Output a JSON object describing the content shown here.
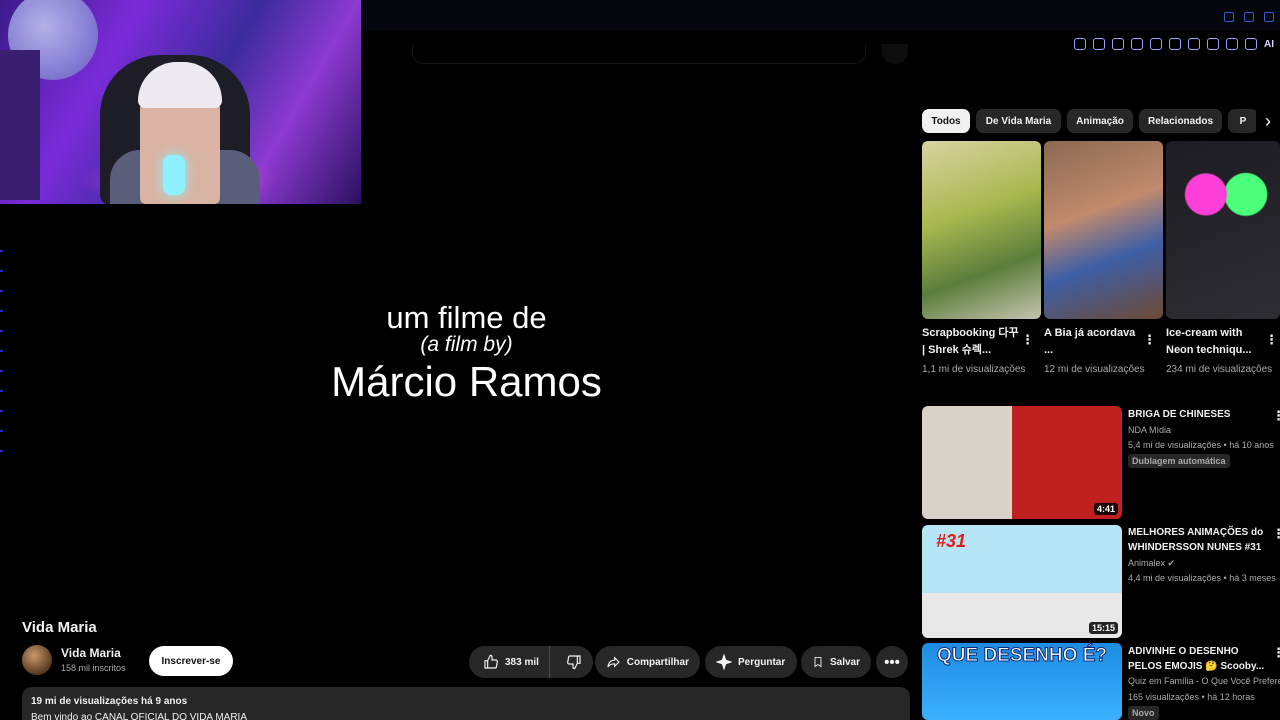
{
  "browser": {
    "ai_label": "AI"
  },
  "video": {
    "credit_line1": "um filme de",
    "credit_line2": "(a film by)",
    "credit_line3": "Márcio Ramos",
    "title": "Vida Maria"
  },
  "channel": {
    "name": "Vida Maria",
    "subscribers": "158 mil inscritos",
    "subscribe_label": "Inscrever-se"
  },
  "actions": {
    "likes": "383 mil",
    "share_label": "Compartilhar",
    "ask_label": "Perguntar",
    "save_label": "Salvar"
  },
  "description": {
    "meta": "19 mi de visualizações  há 9 anos",
    "text": "Bem vindo ao CANAL OFICIAL DO VIDA MARIA"
  },
  "chips": [
    "Todos",
    "De Vida Maria",
    "Animação",
    "Relacionados",
    "P"
  ],
  "shorts": [
    {
      "title": "Scrapbooking 다꾸 | Shrek 슈렉...",
      "views": "1,1 mi de visualizações"
    },
    {
      "title": "A Bia já acordava ...",
      "views": "12 mi de visualizações"
    },
    {
      "title": "Ice-cream with Neon techniqu...",
      "views": "234 mi de visualizações"
    }
  ],
  "sidebar_videos": [
    {
      "title": "BRIGA DE CHINESES",
      "channel": "NDA Mídia",
      "meta": "5,4 mi de visualizações • há 10 anos",
      "badge": "Dublagem automática",
      "duration": "4:41"
    },
    {
      "title": "MELHORES ANIMAÇÕES do WHINDERSSON NUNES #31",
      "channel": "Animalex ✔",
      "meta": "4,4 mi de visualizações • há 3 meses",
      "duration": "15:15",
      "thumb_text": "#31"
    },
    {
      "title": "ADIVINHE O DESENHO PELOS EMOJIS 🤔 Scooby...",
      "channel": "Quiz em Família - O Que Você Prefere",
      "meta": "165 visualizações • há 12 horas",
      "badge": "Novo",
      "thumb_text": "QUE DESENHO É?"
    }
  ],
  "colors": {
    "accent_blue": "#3a57c8",
    "chip_bg": "#272727",
    "chip_active_bg": "#f1f1f1",
    "page_bg": "#000000"
  }
}
